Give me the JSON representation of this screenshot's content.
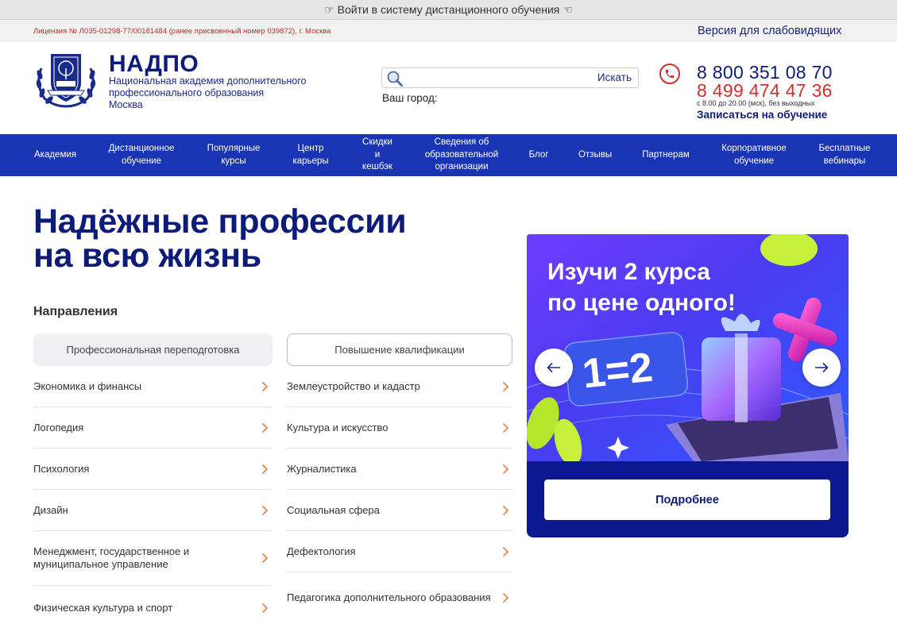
{
  "topbar": {
    "text": "☞ Войти в систему дистанционного обучения ☜"
  },
  "infobar": {
    "license": "Лицензия № Л035-01298-77/00181484 (ранее присвоенный номер 039872), г. Москва",
    "vision_link": "Версия для слабовидящих"
  },
  "header": {
    "brand_title": "НАДПО",
    "brand_subtitle": "Национальная академия дополнительного профессионального образования",
    "brand_city": "Москва",
    "logo_text": "НАДПО",
    "search": {
      "placeholder": "",
      "button": "Искать"
    },
    "city_label": "Ваш город:",
    "phone1": "8 800 351 08 70",
    "phone2": "8 499 474 47 36",
    "phone_hours": "с 8.00 до 20.00 (мск), без выходных",
    "enroll_link": "Записаться на обучение"
  },
  "nav": {
    "items": [
      {
        "label": "Академия"
      },
      {
        "label": "Дистанционное обучение"
      },
      {
        "label": "Популярные курсы"
      },
      {
        "label": "Центр карьеры"
      },
      {
        "label": "Скидки и кешбэк"
      },
      {
        "label": "Сведения об образовательной организации"
      },
      {
        "label": "Блог"
      },
      {
        "label": "Отзывы"
      },
      {
        "label": "Партнерам"
      },
      {
        "label": "Корпоративное обучение"
      },
      {
        "label": "Бесплатные вебинары"
      }
    ]
  },
  "main": {
    "hero_title_line1": "Надёжные профессии",
    "hero_title_line2": "на всю жизнь",
    "directions_title": "Направления",
    "tabs": [
      {
        "label": "Профессиональная переподготовка",
        "active": true
      },
      {
        "label": "Повышение квалификации",
        "active": false
      }
    ],
    "left_column": [
      {
        "label": "Экономика и финансы"
      },
      {
        "label": "Логопедия"
      },
      {
        "label": "Психология"
      },
      {
        "label": "Дизайн"
      },
      {
        "label": "Менеджмент, государственное и муниципальное управление"
      },
      {
        "label": "Физическая культура и спорт"
      }
    ],
    "right_column": [
      {
        "label": "Землеустройство и кадастр"
      },
      {
        "label": "Культура и искусство"
      },
      {
        "label": "Журналистика"
      },
      {
        "label": "Социальная сфера"
      },
      {
        "label": "Дефектология"
      },
      {
        "label": "Педагогика дополнительного образования"
      }
    ]
  },
  "banner": {
    "title_line1": "Изучи 2 курса",
    "title_line2": "по цене одного!",
    "badge": "1=2",
    "more_button": "Подробнее"
  },
  "colors": {
    "brand_blue": "#0d1b7a",
    "nav_blue": "#1a35b3",
    "accent_red": "#d32f2f",
    "chevron_orange": "#f07c3c"
  }
}
